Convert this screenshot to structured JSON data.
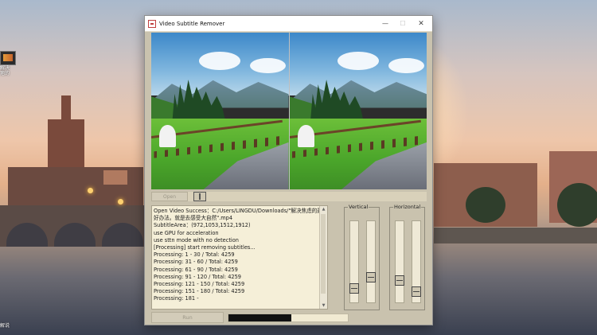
{
  "desktop": {
    "icon_label": "解决\n疤的",
    "bottom_label": "解说"
  },
  "window": {
    "title": "Video Subtitle Remover",
    "min_symbol": "—",
    "max_symbol": "☐",
    "close_symbol": "✕"
  },
  "video": {
    "open_label": "Open",
    "run_label": "Run",
    "progress": 0.525
  },
  "log": {
    "lines": [
      "Open Video Success：C:/Users/LINGDU/Downloads/\"解决焦虑的最",
      "好办法。就是去感受大自然\".mp4",
      "SubtitleArea：(972,1053,1512,1912)",
      "use GPU for acceleration",
      "use sttn mode with no detection",
      "[Processing] start removing subtitles...",
      "Processing: 1 - 30  / Total: 4259",
      "Processing: 31 - 60  / Total: 4259",
      "Processing: 61 - 90  / Total: 4259",
      "Processing: 91 - 120  / Total: 4259",
      "Processing: 121 - 150  / Total: 4259",
      "Processing: 151 - 180  / Total: 4259",
      "Processing: 181 -"
    ]
  },
  "vertical": {
    "label": "Vertical",
    "slider1_value": 0.88,
    "slider2_value": 0.72
  },
  "horizontal": {
    "label": "Horizontal",
    "slider1_value": 0.76,
    "slider2_value": 0.92
  },
  "icons": {
    "app": "scissors-icon",
    "scroll_up": "arrow-up-icon",
    "scroll_down": "arrow-down-icon"
  }
}
